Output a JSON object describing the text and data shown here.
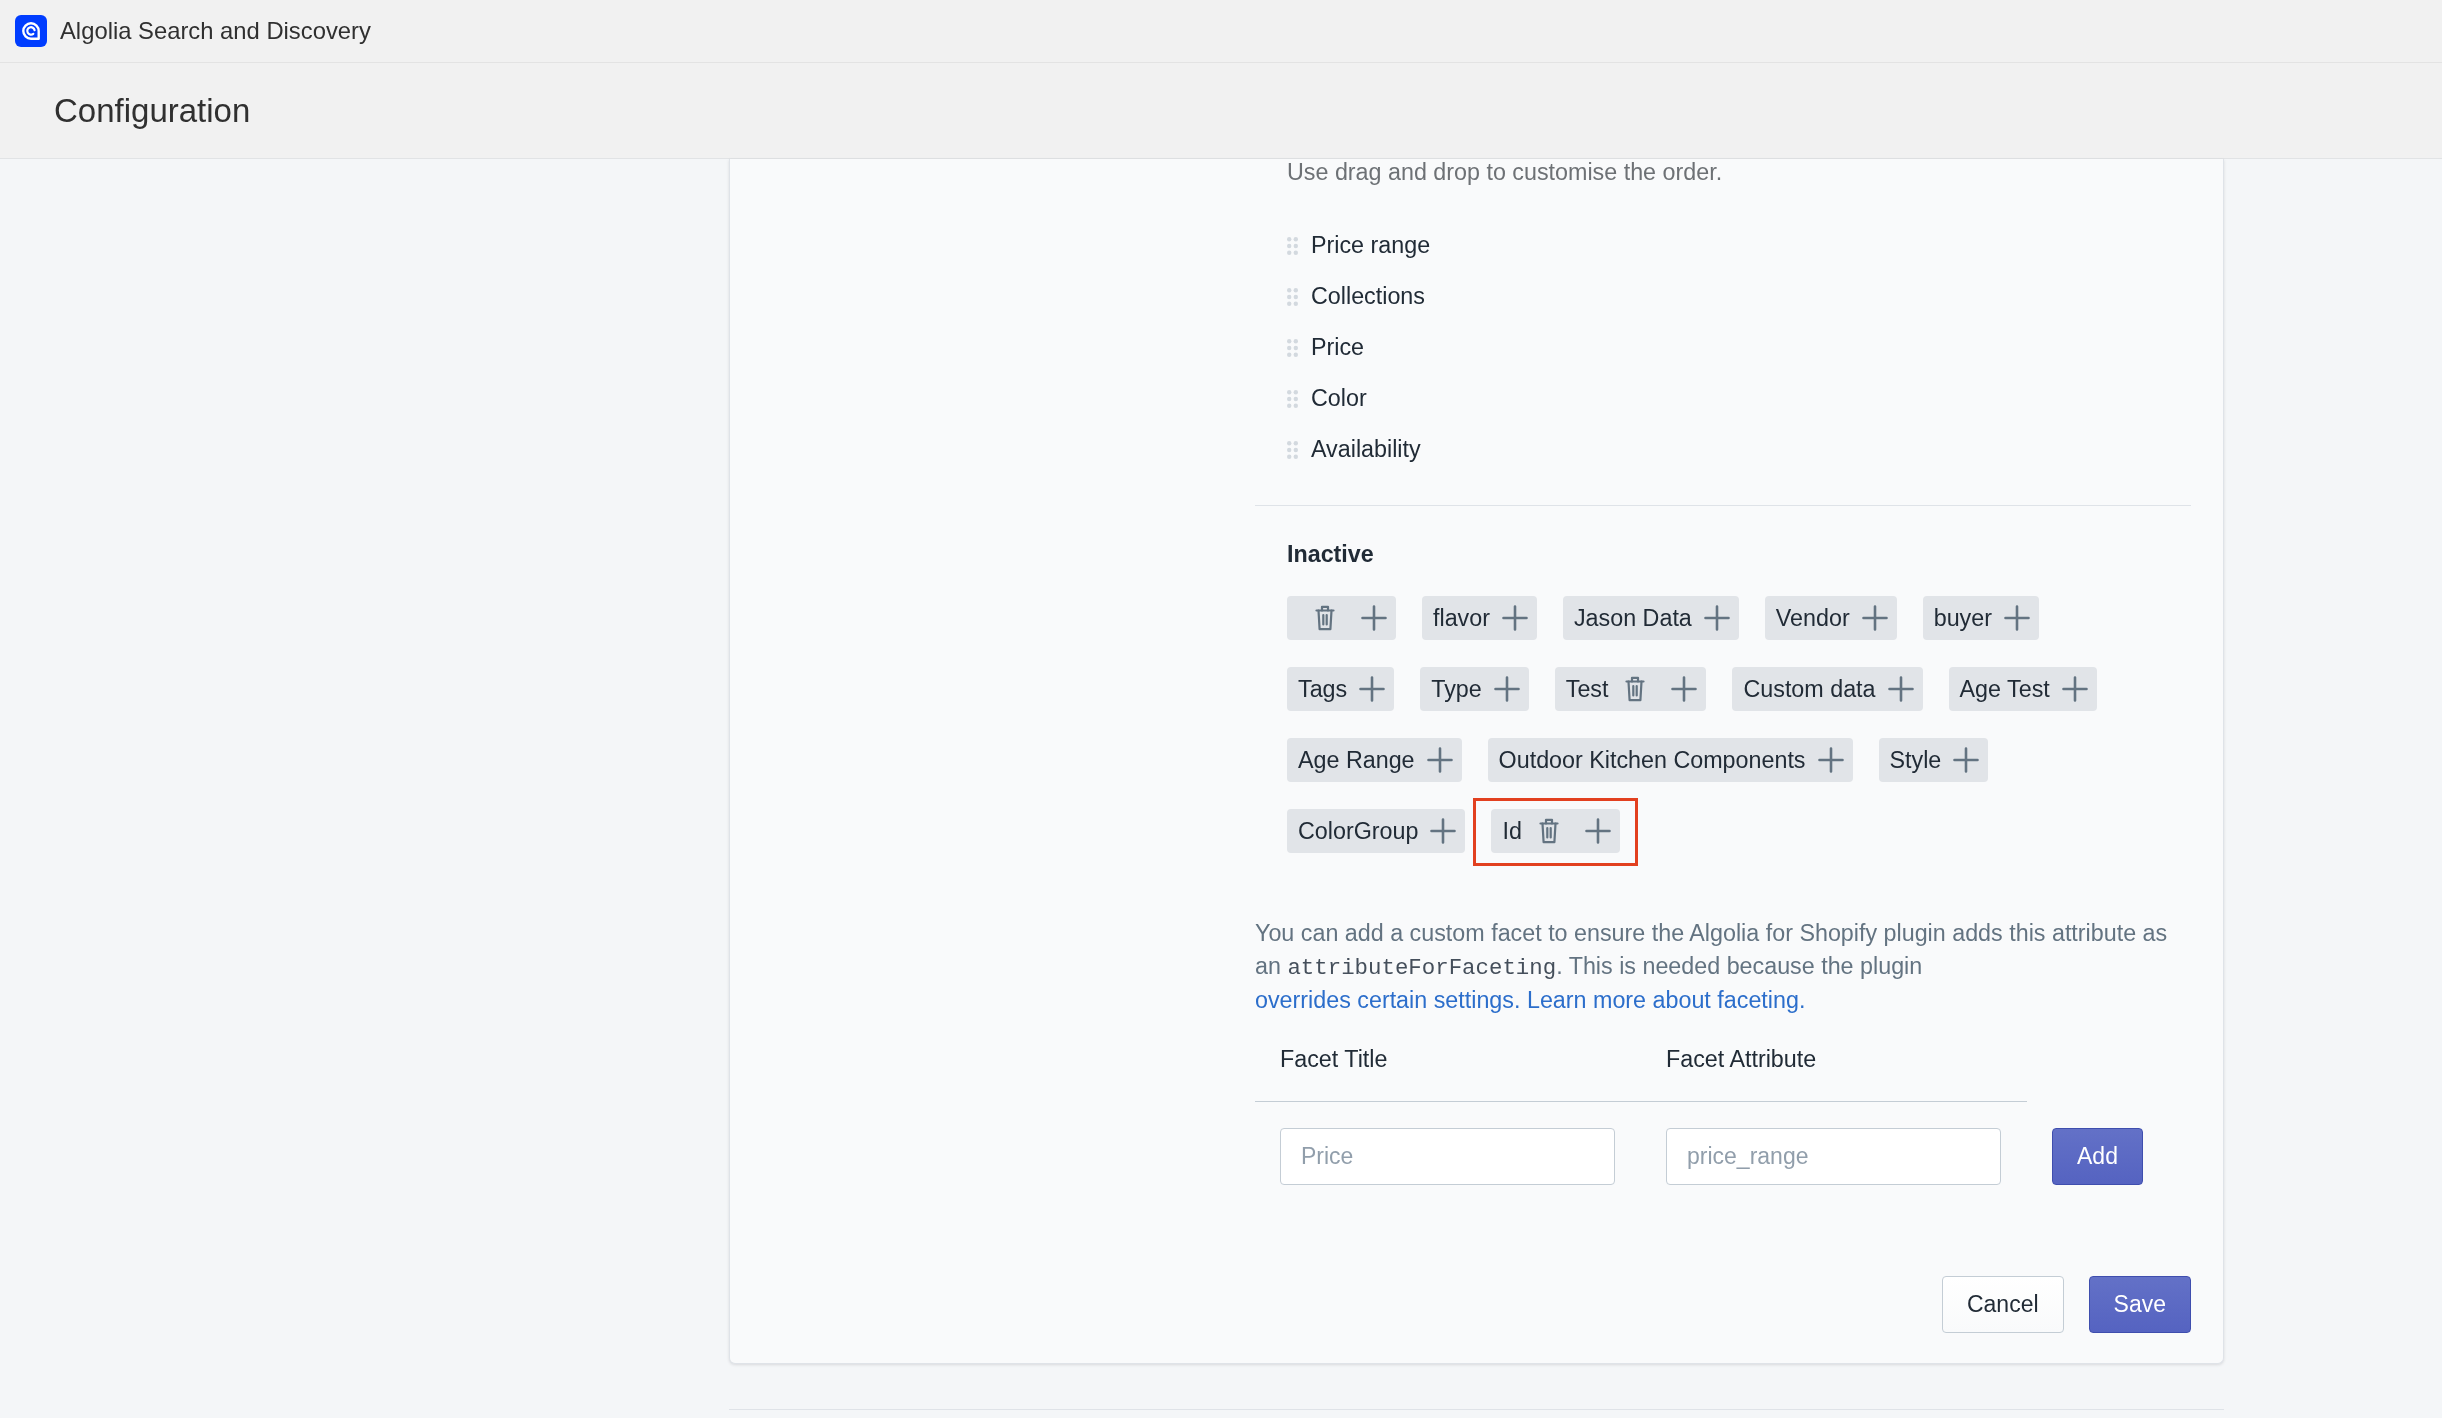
{
  "app_bar": {
    "title": "Algolia Search and Discovery"
  },
  "page_header": {
    "title": "Configuration"
  },
  "facets": {
    "hint": "Use drag and drop to customise the order.",
    "active": [
      "Price range",
      "Collections",
      "Price",
      "Color",
      "Availability"
    ],
    "inactive_heading": "Inactive",
    "inactive": [
      {
        "deletable": true,
        "highlighted": false
      },
      {
        "label": "flavor",
        "deletable": false,
        "highlighted": false
      },
      {
        "label": "Jason Data",
        "deletable": false,
        "highlighted": false
      },
      {
        "label": "Vendor",
        "deletable": false,
        "highlighted": false
      },
      {
        "label": "buyer",
        "deletable": false,
        "highlighted": false
      },
      {
        "label": "Tags",
        "deletable": false,
        "highlighted": false
      },
      {
        "label": "Type",
        "deletable": false,
        "highlighted": false
      },
      {
        "label": "Test",
        "deletable": true,
        "highlighted": false
      },
      {
        "label": "Custom data",
        "deletable": false,
        "highlighted": false
      },
      {
        "label": "Age Test",
        "deletable": false,
        "highlighted": false
      },
      {
        "label": "Age Range",
        "deletable": false,
        "highlighted": false
      },
      {
        "label": "Outdoor Kitchen Components",
        "deletable": false,
        "highlighted": false
      },
      {
        "label": "Style",
        "deletable": false,
        "highlighted": false
      },
      {
        "label": "ColorGroup",
        "deletable": false,
        "highlighted": false
      },
      {
        "label": "Id",
        "deletable": true,
        "highlighted": true
      }
    ]
  },
  "custom_facet": {
    "description": [
      {
        "kind": "text",
        "text": "You can add a custom facet to ensure the Algolia for Shopify plugin adds this attribute as an "
      },
      {
        "kind": "code",
        "text": "attributeForFaceting"
      },
      {
        "kind": "text",
        "text": ". This is needed because the plugin "
      },
      {
        "kind": "link",
        "text": "overrides certain settings. Learn more about faceting."
      }
    ],
    "columns": [
      "Facet Title",
      "Facet Attribute"
    ],
    "fields": [
      {
        "placeholder": "Price"
      },
      {
        "placeholder": "price_range"
      }
    ],
    "add_button": "Add"
  },
  "footer_buttons": [
    {
      "label": "Cancel",
      "kind": "secondary"
    },
    {
      "label": "Save",
      "kind": "primary"
    }
  ]
}
